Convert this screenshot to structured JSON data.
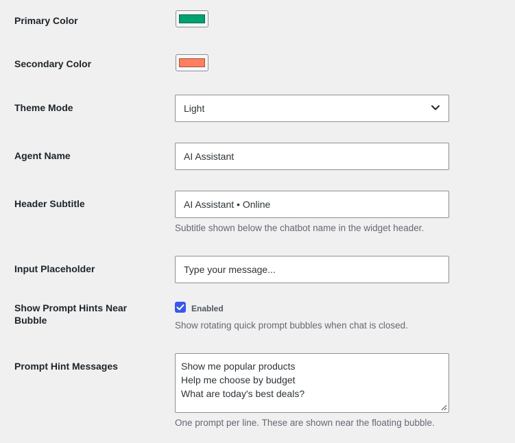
{
  "settings": {
    "primary_color": {
      "label": "Primary Color",
      "value": "#00a071"
    },
    "secondary_color": {
      "label": "Secondary Color",
      "value": "#ff7f5e"
    },
    "theme_mode": {
      "label": "Theme Mode",
      "value": "Light",
      "icon": "chevron-down-icon"
    },
    "agent_name": {
      "label": "Agent Name",
      "value": "AI Assistant"
    },
    "header_subtitle": {
      "label": "Header Subtitle",
      "value": "AI Assistant • Online",
      "description": "Subtitle shown below the chatbot name in the widget header."
    },
    "input_placeholder": {
      "label": "Input Placeholder",
      "value": "Type your message..."
    },
    "prompt_hints": {
      "label": "Show Prompt Hints Near Bubble",
      "checked": true,
      "checkbox_label": "Enabled",
      "description": "Show rotating quick prompt bubbles when chat is closed."
    },
    "prompt_messages": {
      "label": "Prompt Hint Messages",
      "lines": [
        "Show me popular products",
        "Help me choose by budget",
        "What are today's best deals?"
      ],
      "description": "One prompt per line. These are shown near the floating bubble."
    }
  },
  "colors": {
    "page_background": "#f0f0f1",
    "checkbox_accent": "#3858e9",
    "description_text": "#646970"
  }
}
